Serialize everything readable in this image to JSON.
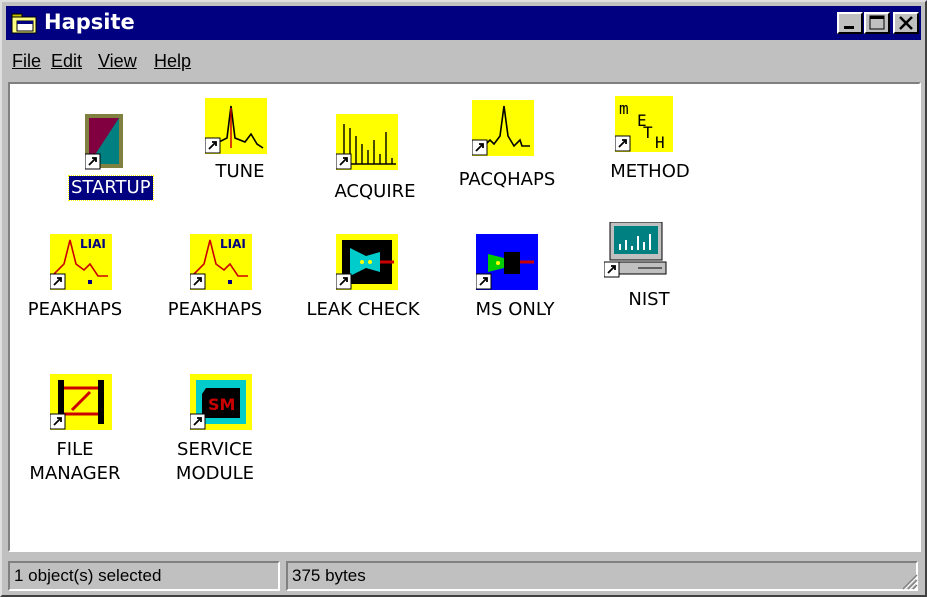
{
  "window": {
    "title": "Hapsite"
  },
  "menu": [
    "File",
    "Edit",
    "View",
    "Help"
  ],
  "icons": [
    {
      "label": "STARTUP",
      "selected": true
    },
    {
      "label": "TUNE"
    },
    {
      "label": "ACQUIRE"
    },
    {
      "label": "PACQHAPS"
    },
    {
      "label": "METHOD"
    },
    {
      "label": "PEAKHAPS"
    },
    {
      "label": "PEAKHAPS"
    },
    {
      "label": "LEAK CHECK"
    },
    {
      "label": "MS ONLY"
    },
    {
      "label": "NIST"
    },
    {
      "label": "FILE\nMANAGER"
    },
    {
      "label": "SERVICE\nMODULE"
    }
  ],
  "status": {
    "selection": "1 object(s) selected",
    "size": "375 bytes"
  },
  "colors": {
    "titlebar": "#000080",
    "icon_yellow": "#ffff00",
    "window_bg": "#c0c0c0"
  }
}
